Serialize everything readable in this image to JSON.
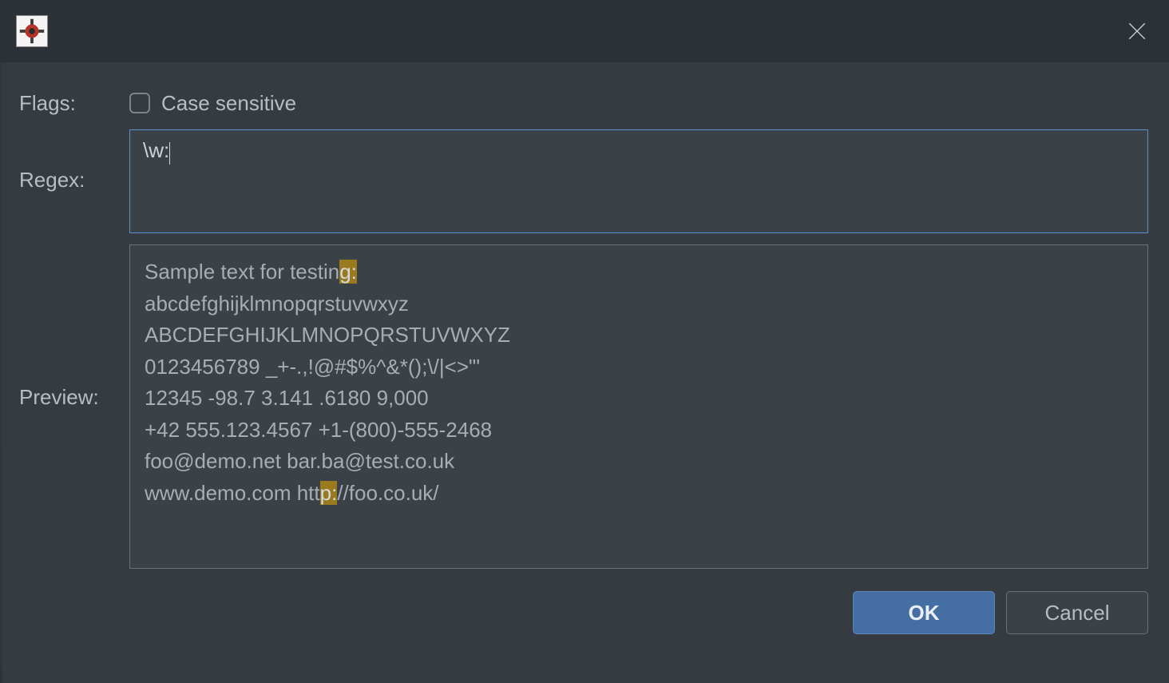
{
  "labels": {
    "flags": "Flags:",
    "regex": "Regex:",
    "preview": "Preview:",
    "case_sensitive": "Case sensitive"
  },
  "regex_value": "\\w:",
  "preview_lines": [
    {
      "text_before": "Sample text for testin",
      "hl": "g:",
      "text_after": ""
    },
    {
      "text_before": "abcdefghijklmnopqrstuvwxyz",
      "hl": "",
      "text_after": ""
    },
    {
      "text_before": "ABCDEFGHIJKLMNOPQRSTUVWXYZ",
      "hl": "",
      "text_after": ""
    },
    {
      "text_before": "0123456789 _+-.,!@#$%^&*();\\/|<>\"'",
      "hl": "",
      "text_after": ""
    },
    {
      "text_before": "12345 -98.7 3.141 .6180 9,000",
      "hl": "",
      "text_after": ""
    },
    {
      "text_before": "+42 555.123.4567 +1-(800)-555-2468",
      "hl": "",
      "text_after": ""
    },
    {
      "text_before": "foo@demo.net bar.ba@test.co.uk",
      "hl": "",
      "text_after": ""
    },
    {
      "text_before": "www.demo.com htt",
      "hl": "p:",
      "text_after": "//foo.co.uk/"
    }
  ],
  "buttons": {
    "ok": "OK",
    "cancel": "Cancel"
  },
  "checkbox_checked": false
}
